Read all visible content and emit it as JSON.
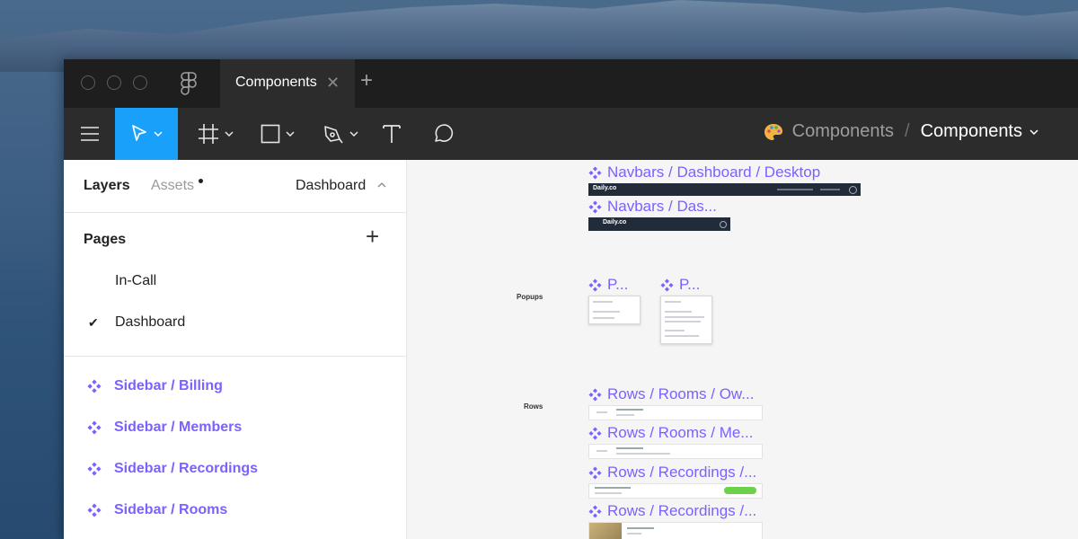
{
  "window": {
    "tab_title": "Components",
    "tab_close": "✕",
    "tab_add": "+"
  },
  "toolbar": {
    "breadcrumb_file": "Components",
    "breadcrumb_separator": "/",
    "breadcrumb_page": "Components",
    "active_tool": "move",
    "accent_color": "#18a0fb"
  },
  "left_panel": {
    "tabs": {
      "layers": "Layers",
      "assets": "Assets"
    },
    "current_page": "Dashboard",
    "pages_title": "Pages",
    "pages_add": "+",
    "pages": [
      {
        "name": "In-Call",
        "selected": false
      },
      {
        "name": "Dashboard",
        "selected": true
      }
    ],
    "check_mark": "✔",
    "layers": [
      {
        "name": "Sidebar / Billing"
      },
      {
        "name": "Sidebar / Members"
      },
      {
        "name": "Sidebar / Recordings"
      },
      {
        "name": "Sidebar / Rooms"
      }
    ],
    "component_color": "#7b61ff"
  },
  "canvas": {
    "frames": [
      {
        "title": "Navbars / Dashboard / Desktop"
      },
      {
        "title": "Navbars / Das..."
      },
      {
        "title": "P..."
      },
      {
        "title": "P..."
      },
      {
        "title": "Rows / Rooms / Ow..."
      },
      {
        "title": "Rows / Rooms / Me..."
      },
      {
        "title": "Rows / Recordings /..."
      },
      {
        "title": "Rows / Recordings /..."
      }
    ],
    "navbar_logo": "Daily.co",
    "section_labels": {
      "popups": "Popups",
      "rows": "Rows"
    }
  }
}
